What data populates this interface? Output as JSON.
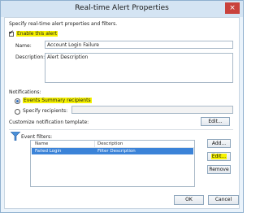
{
  "window": {
    "title": "Real-time Alert Properties",
    "close_glyph": "×"
  },
  "intro_text": "Specify real-time alert properties and filters.",
  "enable": {
    "label": "Enable this alert",
    "checked": true
  },
  "name": {
    "label": "Name:",
    "value": "Account Login Failure"
  },
  "description": {
    "label": "Description:",
    "value": "Alert Description"
  },
  "notifications": {
    "label": "Notifications:",
    "options": [
      {
        "label": "Events Summary recipients",
        "selected": true
      },
      {
        "label": "Specify recipients:",
        "selected": false
      }
    ],
    "specify_value": ""
  },
  "template": {
    "label": "Customize notification template:",
    "edit_label": "Edit..."
  },
  "filters": {
    "label": "Event filters:",
    "columns": [
      "Name",
      "Description"
    ],
    "rows": [
      {
        "name": "Failed Login",
        "description": "Filter Description"
      }
    ],
    "add_label": "Add...",
    "edit_label": "Edit...",
    "remove_label": "Remove"
  },
  "footer": {
    "ok_label": "OK",
    "cancel_label": "Cancel"
  },
  "colors": {
    "highlight": "#f6f200",
    "selection": "#3b83d8",
    "titlebar": "#d4e4f3",
    "close": "#c9423c"
  }
}
